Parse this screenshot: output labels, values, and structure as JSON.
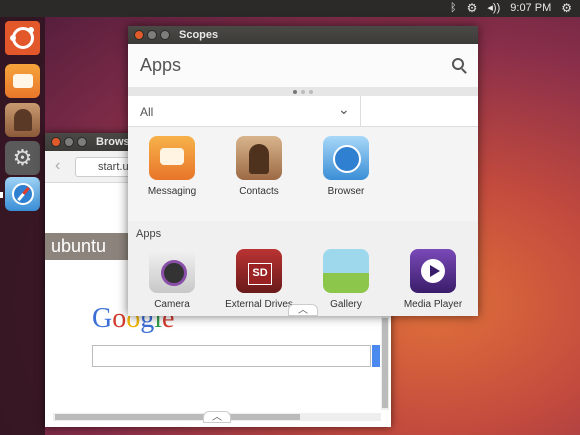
{
  "top_panel": {
    "bluetooth_icon": "bluetooth-icon",
    "network_icon": "gear-icon",
    "volume_icon": "volume-icon",
    "volume_glyph": "◂))",
    "clock": "9:07 PM",
    "settings_icon": "settings-icon",
    "settings_glyph": "⚙"
  },
  "launcher": {
    "items": [
      {
        "name": "dash-home",
        "icon": "ubuntu-logo-icon"
      },
      {
        "name": "messaging",
        "icon": "messaging-icon"
      },
      {
        "name": "contacts",
        "icon": "contacts-icon"
      },
      {
        "name": "system-settings",
        "icon": "gear-icon"
      },
      {
        "name": "browser",
        "icon": "compass-icon"
      }
    ]
  },
  "browser_window": {
    "title": "Browser",
    "url": "start.u",
    "ubuntu_banner": "ubuntu",
    "google_logo": [
      "G",
      "o",
      "o",
      "g",
      "l",
      "e"
    ],
    "google_colors": [
      "#3b6fd6",
      "#d33a2c",
      "#f0b400",
      "#3b6fd6",
      "#2f9c48",
      "#d33a2c"
    ]
  },
  "scopes_window": {
    "title": "Scopes",
    "header": "Apps",
    "filter": "All",
    "section_title": "Apps",
    "top_row": [
      {
        "label": "Messaging",
        "icon": "messaging-icon"
      },
      {
        "label": "Contacts",
        "icon": "contacts-icon"
      },
      {
        "label": "Browser",
        "icon": "browser-icon"
      }
    ],
    "apps_row": [
      {
        "label": "Camera",
        "icon": "camera-icon"
      },
      {
        "label": "External Drives",
        "icon": "sd-card-icon"
      },
      {
        "label": "Gallery",
        "icon": "gallery-icon"
      },
      {
        "label": "Media Player",
        "icon": "media-player-icon"
      }
    ]
  },
  "colors": {
    "accent": "#e05b2a",
    "panel": "#2b2a28",
    "titlebar": "#3c3b37"
  }
}
